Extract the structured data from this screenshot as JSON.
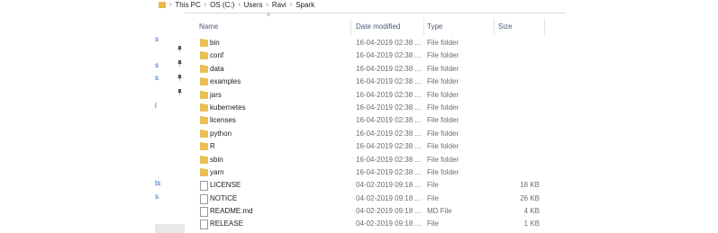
{
  "breadcrumb": {
    "items": [
      {
        "label": "This PC"
      },
      {
        "label": "OS (C:)"
      },
      {
        "label": "Users"
      },
      {
        "label": "Ravi"
      },
      {
        "label": "Spark"
      }
    ]
  },
  "nav_fragments": [
    "s",
    "s",
    "s",
    "l",
    "ts",
    "s"
  ],
  "columns": {
    "name": "Name",
    "date_modified": "Date modified",
    "type": "Type",
    "size": "Size"
  },
  "files": [
    {
      "name": "bin",
      "date": "16-04-2019 02:38 ...",
      "type": "File folder",
      "size": "",
      "kind": "folder"
    },
    {
      "name": "conf",
      "date": "16-04-2019 02:38 ...",
      "type": "File folder",
      "size": "",
      "kind": "folder"
    },
    {
      "name": "data",
      "date": "16-04-2019 02:38 ...",
      "type": "File folder",
      "size": "",
      "kind": "folder"
    },
    {
      "name": "examples",
      "date": "16-04-2019 02:38 ...",
      "type": "File folder",
      "size": "",
      "kind": "folder"
    },
    {
      "name": "jars",
      "date": "16-04-2019 02:38 ...",
      "type": "File folder",
      "size": "",
      "kind": "folder"
    },
    {
      "name": "kubernetes",
      "date": "16-04-2019 02:38 ...",
      "type": "File folder",
      "size": "",
      "kind": "folder"
    },
    {
      "name": "licenses",
      "date": "16-04-2019 02:38 ...",
      "type": "File folder",
      "size": "",
      "kind": "folder"
    },
    {
      "name": "python",
      "date": "16-04-2019 02:38 ...",
      "type": "File folder",
      "size": "",
      "kind": "folder"
    },
    {
      "name": "R",
      "date": "16-04-2019 02:38 ...",
      "type": "File folder",
      "size": "",
      "kind": "folder"
    },
    {
      "name": "sbin",
      "date": "16-04-2019 02:38 ...",
      "type": "File folder",
      "size": "",
      "kind": "folder"
    },
    {
      "name": "yarn",
      "date": "16-04-2019 02:38 ...",
      "type": "File folder",
      "size": "",
      "kind": "folder"
    },
    {
      "name": "LICENSE",
      "date": "04-02-2019 09:18 ...",
      "type": "File",
      "size": "18 KB",
      "kind": "file"
    },
    {
      "name": "NOTICE",
      "date": "04-02-2019 09:18 ...",
      "type": "File",
      "size": "26 KB",
      "kind": "file"
    },
    {
      "name": "README.md",
      "date": "04-02-2019 09:18 ...",
      "type": "MD File",
      "size": "4 KB",
      "kind": "file"
    },
    {
      "name": "RELEASE",
      "date": "04-02-2019 09:18 ...",
      "type": "File",
      "size": "1 KB",
      "kind": "file"
    }
  ],
  "colors": {
    "folder": "#ecbf55",
    "header_text": "#4a5a78",
    "nav_link": "#2a62b8"
  }
}
